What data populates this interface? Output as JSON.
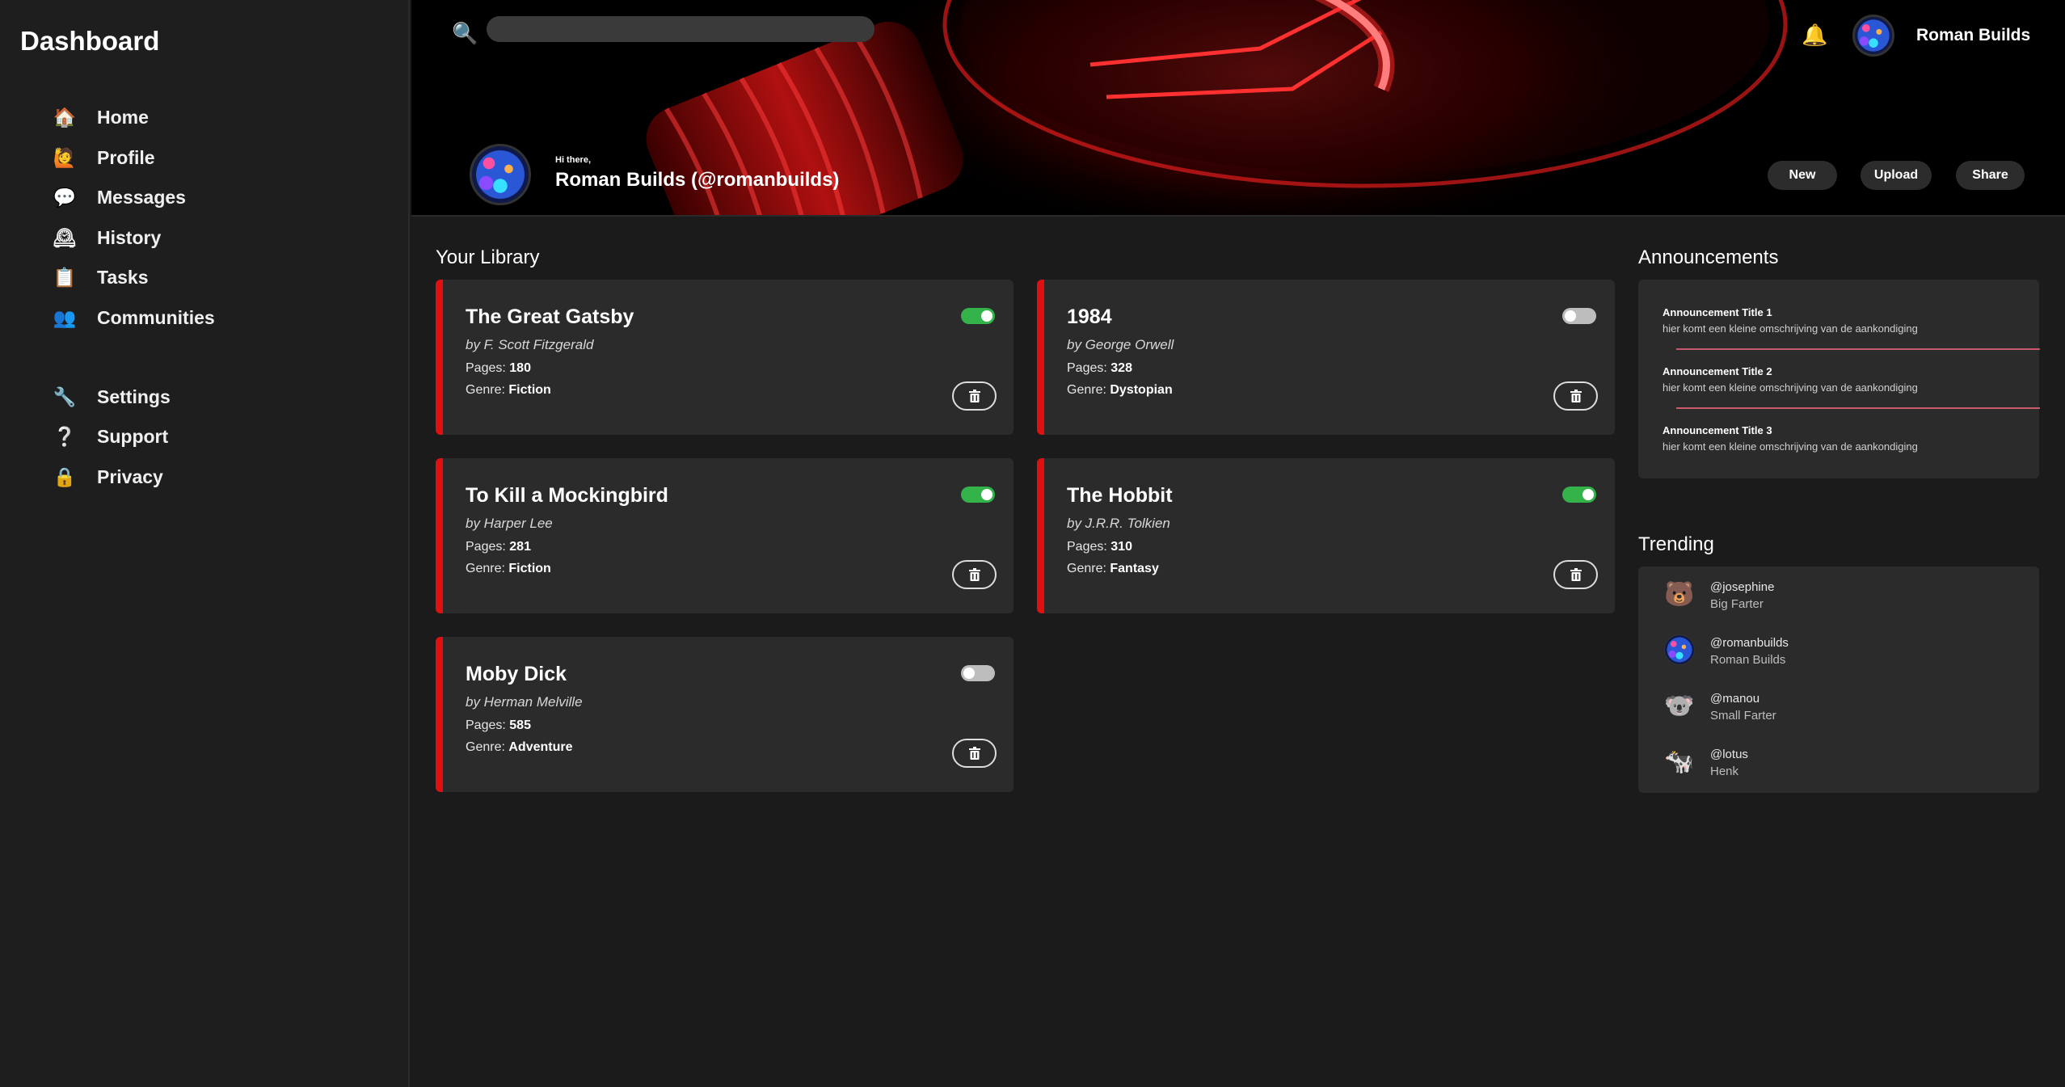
{
  "sidebar": {
    "title": "Dashboard",
    "primary": [
      {
        "label": "Home",
        "icon": "🏠"
      },
      {
        "label": "Profile",
        "icon": "🙋"
      },
      {
        "label": "Messages",
        "icon": "💬"
      },
      {
        "label": "History",
        "icon": "🕰"
      },
      {
        "label": "Tasks",
        "icon": "📋"
      },
      {
        "label": "Communities",
        "icon": "👥"
      }
    ],
    "secondary": [
      {
        "label": "Settings",
        "icon": "🔧"
      },
      {
        "label": "Support",
        "icon": "❔"
      },
      {
        "label": "Privacy",
        "icon": "🔒"
      }
    ]
  },
  "header": {
    "search": {
      "placeholder": "",
      "value": "",
      "icon": "🔍"
    },
    "bell_icon": "🔔",
    "username": "Roman Builds",
    "greeting": "Hi there,",
    "profile_name": "Roman Builds (@romanbuilds)",
    "buttons": {
      "new": "New",
      "upload": "Upload",
      "share": "Share"
    }
  },
  "library": {
    "title": "Your Library",
    "pages_label": "Pages:",
    "genre_label": "Genre:",
    "books": [
      {
        "title": "The Great Gatsby",
        "author": "by F. Scott Fitzgerald",
        "pages": "180",
        "genre": "Fiction",
        "enabled": true
      },
      {
        "title": "1984",
        "author": "by George Orwell",
        "pages": "328",
        "genre": "Dystopian",
        "enabled": false
      },
      {
        "title": "To Kill a Mockingbird",
        "author": "by Harper Lee",
        "pages": "281",
        "genre": "Fiction",
        "enabled": true
      },
      {
        "title": "The Hobbit",
        "author": "by J.R.R. Tolkien",
        "pages": "310",
        "genre": "Fantasy",
        "enabled": true
      },
      {
        "title": "Moby Dick",
        "author": "by Herman Melville",
        "pages": "585",
        "genre": "Adventure",
        "enabled": false
      }
    ]
  },
  "announcements": {
    "title": "Announcements",
    "items": [
      {
        "title": "Announcement Title 1",
        "description": "hier komt een kleine omschrijving van de aankondiging"
      },
      {
        "title": "Announcement Title 2",
        "description": "hier komt een kleine omschrijving van de aankondiging"
      },
      {
        "title": "Announcement Title 3",
        "description": "hier komt een kleine omschrijving van de aankondiging"
      }
    ]
  },
  "trending": {
    "title": "Trending",
    "items": [
      {
        "handle": "@josephine",
        "name": "Big Farter",
        "icon": "🐻"
      },
      {
        "handle": "@romanbuilds",
        "name": "Roman Builds",
        "icon": "avatar"
      },
      {
        "handle": "@manou",
        "name": "Small Farter",
        "icon": "🐨"
      },
      {
        "handle": "@lotus",
        "name": "Henk",
        "icon": "🐄"
      }
    ]
  },
  "colors": {
    "accent_red": "#e01010",
    "toggle_on": "#34b34a",
    "toggle_off": "#bdbdbd",
    "divider": "#c85a6c",
    "card_bg": "#2b2b2b",
    "page_bg": "#1b1b1b"
  }
}
